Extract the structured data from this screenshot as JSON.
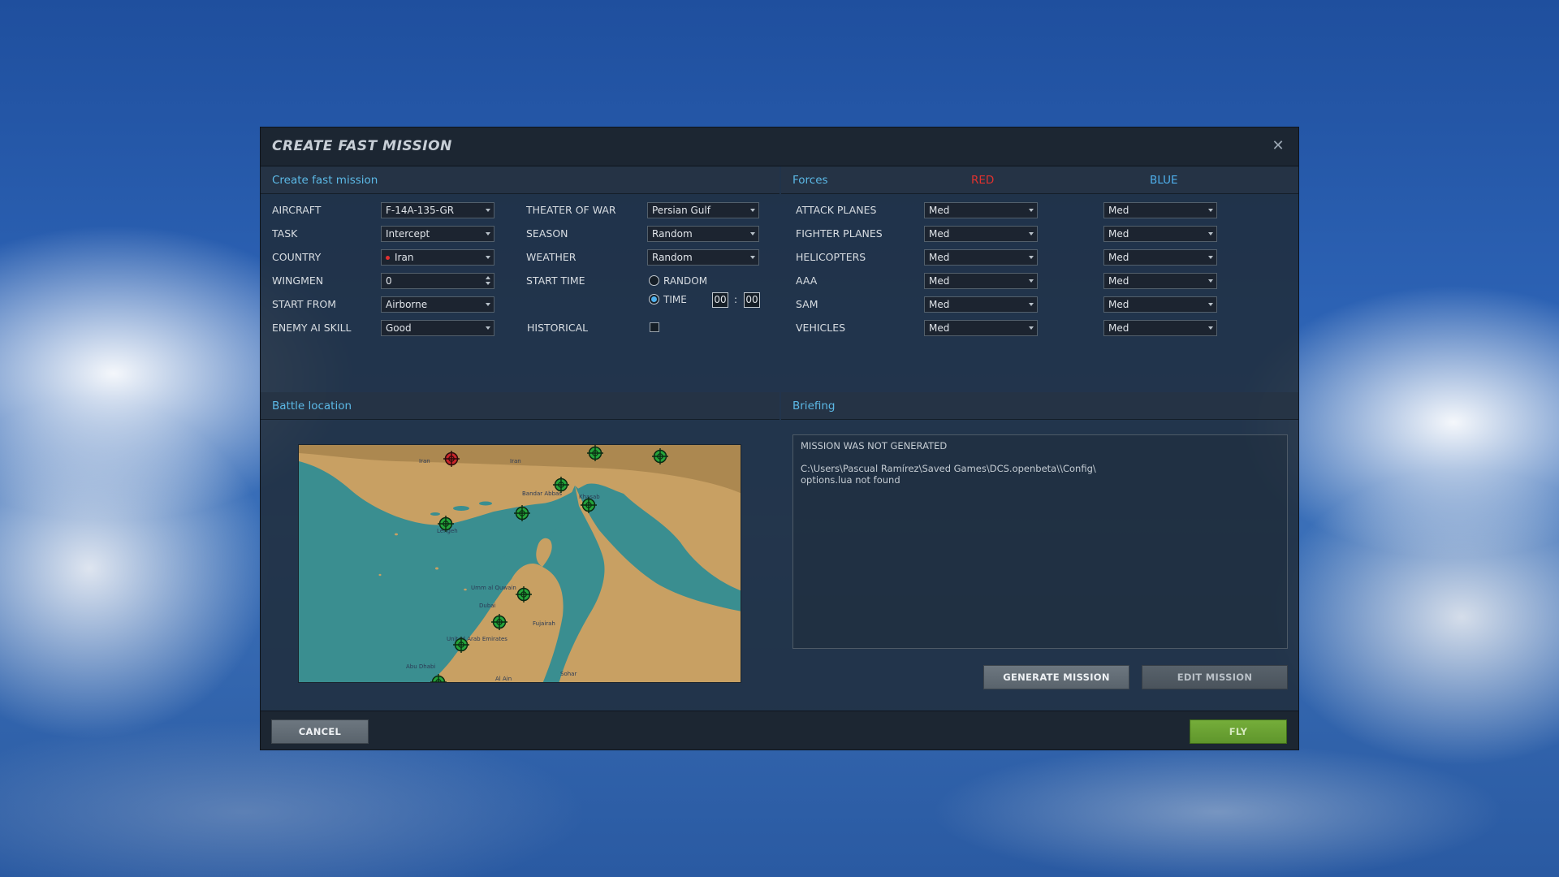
{
  "dialog": {
    "title": "CREATE FAST MISSION",
    "close_glyph": "✕"
  },
  "create": {
    "header": "Create fast mission",
    "fields": [
      {
        "label": "AIRCRAFT",
        "value": "F-14A-135-GR"
      },
      {
        "label": "TASK",
        "value": "Intercept"
      },
      {
        "label": "COUNTRY",
        "value": "Iran"
      },
      {
        "label": "WINGMEN",
        "value": "0"
      },
      {
        "label": "START FROM",
        "value": "Airborne"
      },
      {
        "label": "ENEMY AI SKILL",
        "value": "Good"
      }
    ],
    "env": [
      {
        "label": "THEATER OF WAR",
        "value": "Persian Gulf"
      },
      {
        "label": "SEASON",
        "value": "Random"
      },
      {
        "label": "WEATHER",
        "value": "Random"
      }
    ],
    "start_time": {
      "label": "START TIME",
      "random_label": "RANDOM",
      "time_label": "TIME",
      "hours": "00",
      "separator": ":",
      "minutes": "00"
    },
    "historical_label": "HISTORICAL"
  },
  "forces": {
    "header": "Forces",
    "red_label": "RED",
    "blue_label": "BLUE",
    "red_color": "#e0322e",
    "blue_color": "#4fb0ec",
    "rows": [
      {
        "label": "ATTACK PLANES",
        "red": "Med",
        "blue": "Med"
      },
      {
        "label": "FIGHTER PLANES",
        "red": "Med",
        "blue": "Med"
      },
      {
        "label": "HELICOPTERS",
        "red": "Med",
        "blue": "Med"
      },
      {
        "label": "AAA",
        "red": "Med",
        "blue": "Med"
      },
      {
        "label": "SAM",
        "red": "Med",
        "blue": "Med"
      },
      {
        "label": "VEHICLES",
        "red": "Med",
        "blue": "Med"
      }
    ]
  },
  "battle": {
    "header": "Battle location",
    "map_labels": [
      "Iran",
      "Bandar Abbas",
      "Lengeh",
      "Khasab",
      "Umm al Quwain",
      "Dubai",
      "United Arab Emirates",
      "Fujairah",
      "Abu Dhabi",
      "Al Ain",
      "Sohar"
    ]
  },
  "briefing": {
    "header": "Briefing",
    "status": "MISSION WAS NOT GENERATED",
    "line1": "C:\\Users\\Pascual Ramírez\\Saved Games\\DCS.openbeta\\\\Config\\",
    "line2": "options.lua not found"
  },
  "buttons": {
    "generate": "GENERATE MISSION",
    "edit": "EDIT MISSION",
    "cancel": "CANCEL",
    "fly": "FLY"
  }
}
